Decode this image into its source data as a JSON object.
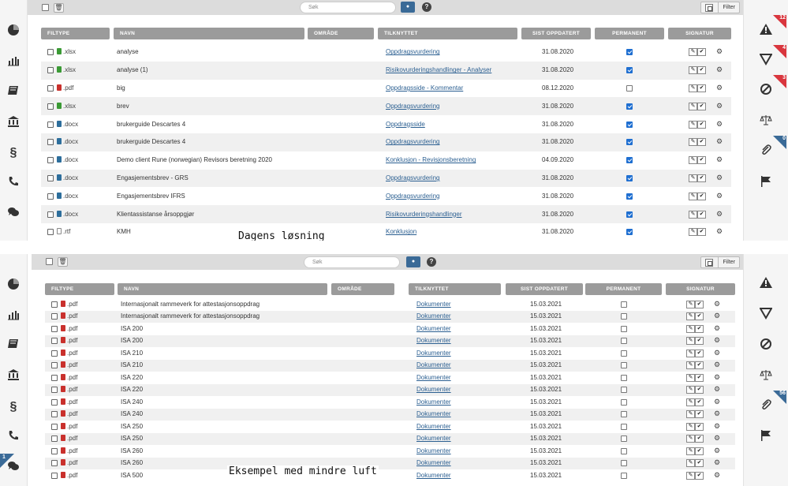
{
  "colors": {
    "header": "#9b9b9b",
    "link": "#2b5f91",
    "accent": "#3a6a97",
    "badge": "#d9363e"
  },
  "toolbar": {
    "trash_icon": "trash-icon",
    "search_placeholder": "Søk",
    "filter_label": "Filter",
    "help_label": "?"
  },
  "columns": [
    "FILTYPE",
    "NAVN",
    "OMRÅDE",
    "TILKNYTTET",
    "SIST OPPDATERT",
    "PERMANENT",
    "SIGNATUR"
  ],
  "signature": {
    "edit_glyph": "✎",
    "check_glyph": "✔"
  },
  "left_icons": [
    "pie-chart-icon",
    "bar-chart-icon",
    "book-icon",
    "bank-icon",
    "paragraph-icon",
    "phone-icon",
    "chat-icon"
  ],
  "paragraph_glyph": "§",
  "right_icons": [
    "warning-icon",
    "filter-icon",
    "ban-icon",
    "scale-icon",
    "paperclip-icon",
    "flag-icon"
  ],
  "panel1": {
    "caption": "Dagens løsning",
    "right_badges": [
      {
        "index": 0,
        "value": "12"
      },
      {
        "index": 1,
        "value": "4"
      },
      {
        "index": 2,
        "value": "3"
      },
      {
        "index": 4,
        "value": "0"
      }
    ],
    "rows": [
      {
        "icon": "green",
        "ext": ".xlsx",
        "name": "analyse",
        "link": "Oppdragsvurdering",
        "date": "31.08.2020",
        "perm": true
      },
      {
        "icon": "green",
        "ext": ".xlsx",
        "name": "analyse (1)",
        "link": "Risikovurderingshandlinger - Analyser",
        "date": "31.08.2020",
        "perm": true
      },
      {
        "icon": "red",
        "ext": ".pdf",
        "name": "big",
        "link": "Oppdragsside - Kommentar",
        "date": "08.12.2020",
        "perm": false
      },
      {
        "icon": "green",
        "ext": ".xlsx",
        "name": "brev",
        "link": "Oppdragsvurdering",
        "date": "31.08.2020",
        "perm": true
      },
      {
        "icon": "blue",
        "ext": ".docx",
        "name": "brukerguide Descartes 4",
        "link": "Oppdragsside",
        "date": "31.08.2020",
        "perm": true
      },
      {
        "icon": "blue",
        "ext": ".docx",
        "name": "brukerguide Descartes 4",
        "link": "Oppdragsvurdering",
        "date": "31.08.2020",
        "perm": true
      },
      {
        "icon": "blue",
        "ext": ".docx",
        "name": "Demo client Rune (norwegian) Revisors beretning 2020",
        "link": "Konklusjon - Revisjonsberetning",
        "date": "04.09.2020",
        "perm": true
      },
      {
        "icon": "blue",
        "ext": ".docx",
        "name": "Engasjementsbrev - GRS",
        "link": "Oppdragsvurdering",
        "date": "31.08.2020",
        "perm": true
      },
      {
        "icon": "blue",
        "ext": ".docx",
        "name": "Engasjementsbrev IFRS",
        "link": "Oppdragsvurdering",
        "date": "31.08.2020",
        "perm": true
      },
      {
        "icon": "blue",
        "ext": ".docx",
        "name": "Klientassistanse årsoppgjør",
        "link": "Risikovurderingshandlinger",
        "date": "31.08.2020",
        "perm": true
      },
      {
        "icon": "grey",
        "ext": ".rtf",
        "name": "KMH",
        "link": "Konklusjon",
        "date": "31.08.2020",
        "perm": true
      }
    ]
  },
  "panel2": {
    "caption": "Eksempel med mindre luft",
    "left_badge": "1",
    "right_badges": [
      {
        "index": 4,
        "value": "56"
      }
    ],
    "rows": [
      {
        "icon": "red",
        "ext": ".pdf",
        "name": "Internasjonalt rammeverk for attestasjonsoppdrag",
        "link": "Dokumenter",
        "date": "15.03.2021",
        "perm": false
      },
      {
        "icon": "red",
        "ext": ".pdf",
        "name": "Internasjonalt rammeverk for attestasjonsoppdrag",
        "link": "Dokumenter",
        "date": "15.03.2021",
        "perm": false
      },
      {
        "icon": "red",
        "ext": ".pdf",
        "name": "ISA 200",
        "link": "Dokumenter",
        "date": "15.03.2021",
        "perm": false
      },
      {
        "icon": "red",
        "ext": ".pdf",
        "name": "ISA 200",
        "link": "Dokumenter",
        "date": "15.03.2021",
        "perm": false
      },
      {
        "icon": "red",
        "ext": ".pdf",
        "name": "ISA 210",
        "link": "Dokumenter",
        "date": "15.03.2021",
        "perm": false
      },
      {
        "icon": "red",
        "ext": ".pdf",
        "name": "ISA 210",
        "link": "Dokumenter",
        "date": "15.03.2021",
        "perm": false
      },
      {
        "icon": "red",
        "ext": ".pdf",
        "name": "ISA 220",
        "link": "Dokumenter",
        "date": "15.03.2021",
        "perm": false
      },
      {
        "icon": "red",
        "ext": ".pdf",
        "name": "ISA 220",
        "link": "Dokumenter",
        "date": "15.03.2021",
        "perm": false
      },
      {
        "icon": "red",
        "ext": ".pdf",
        "name": "ISA 240",
        "link": "Dokumenter",
        "date": "15.03.2021",
        "perm": false
      },
      {
        "icon": "red",
        "ext": ".pdf",
        "name": "ISA 240",
        "link": "Dokumenter",
        "date": "15.03.2021",
        "perm": false
      },
      {
        "icon": "red",
        "ext": ".pdf",
        "name": "ISA 250",
        "link": "Dokumenter",
        "date": "15.03.2021",
        "perm": false
      },
      {
        "icon": "red",
        "ext": ".pdf",
        "name": "ISA 250",
        "link": "Dokumenter",
        "date": "15.03.2021",
        "perm": false
      },
      {
        "icon": "red",
        "ext": ".pdf",
        "name": "ISA 260",
        "link": "Dokumenter",
        "date": "15.03.2021",
        "perm": false
      },
      {
        "icon": "red",
        "ext": ".pdf",
        "name": "ISA 260",
        "link": "Dokumenter",
        "date": "15.03.2021",
        "perm": false
      },
      {
        "icon": "red",
        "ext": ".pdf",
        "name": "ISA 500",
        "link": "Dokumenter",
        "date": "15.03.2021",
        "perm": false
      }
    ]
  }
}
